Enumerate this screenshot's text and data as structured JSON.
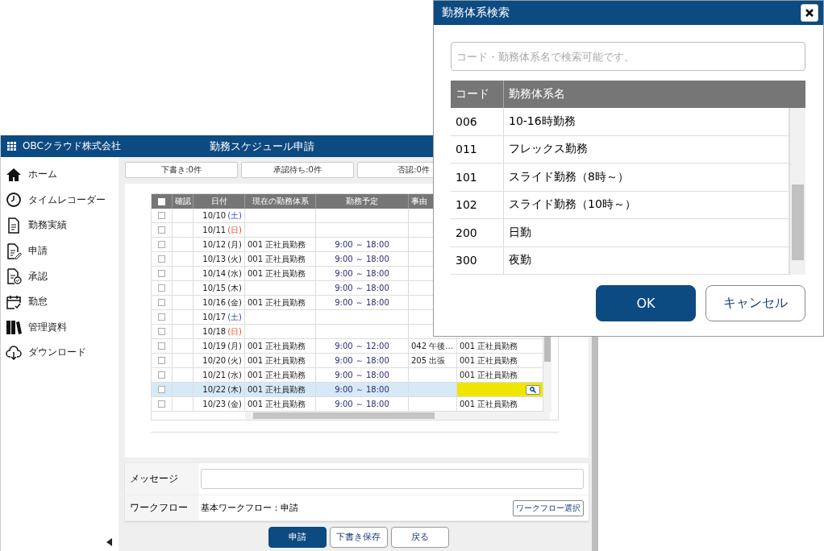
{
  "app": {
    "company": "OBCクラウド株式会社",
    "title": "勤務スケジュール申請"
  },
  "sidebar": {
    "items": [
      {
        "label": "ホーム"
      },
      {
        "label": "タイムレコーダー"
      },
      {
        "label": "勤務実績"
      },
      {
        "label": "申請"
      },
      {
        "label": "承認"
      },
      {
        "label": "勤怠"
      },
      {
        "label": "管理資料"
      },
      {
        "label": "ダウンロード"
      }
    ]
  },
  "status_tabs": [
    "下書き:0件",
    "承認待ち:0件",
    "否認:0件"
  ],
  "table": {
    "all_checked": false,
    "columns": [
      "確認",
      "日付",
      "現在の勤務体系",
      "勤務予定",
      "事由"
    ],
    "rows": [
      {
        "date": "10/10",
        "weekday": "(土)",
        "kind": "saturday",
        "current": "",
        "plan": "",
        "reason": "",
        "column_7": "",
        "selected": false,
        "checked": false
      },
      {
        "date": "10/11",
        "weekday": "(日)",
        "kind": "sunday",
        "current": "",
        "plan": "",
        "reason": "",
        "column_7": "",
        "selected": false,
        "checked": false
      },
      {
        "date": "10/12",
        "weekday": "(月)",
        "kind": "weekday",
        "current": "001 正社員勤務",
        "plan": "9:00 ～ 18:00",
        "reason": "",
        "column_7": "",
        "selected": false,
        "checked": false
      },
      {
        "date": "10/13",
        "weekday": "(火)",
        "kind": "weekday",
        "current": "001 正社員勤務",
        "plan": "9:00 ～ 18:00",
        "reason": "",
        "column_7": "",
        "selected": false,
        "checked": false
      },
      {
        "date": "10/14",
        "weekday": "(水)",
        "kind": "weekday",
        "current": "001 正社員勤務",
        "plan": "9:00 ～ 18:00",
        "reason": "",
        "column_7": "",
        "selected": false,
        "checked": false
      },
      {
        "date": "10/15",
        "weekday": "(木)",
        "kind": "weekday",
        "current": "",
        "plan": "9:00 ～ 18:00",
        "reason": "",
        "column_7": "",
        "selected": false,
        "checked": false
      },
      {
        "date": "10/16",
        "weekday": "(金)",
        "kind": "weekday",
        "current": "001 正社員勤務",
        "plan": "9:00 ～ 18:00",
        "reason": "",
        "column_7": "",
        "selected": false,
        "checked": false
      },
      {
        "date": "10/17",
        "weekday": "(土)",
        "kind": "saturday",
        "current": "",
        "plan": "",
        "reason": "",
        "column_7": "",
        "selected": false,
        "checked": false
      },
      {
        "date": "10/18",
        "weekday": "(日)",
        "kind": "sunday",
        "current": "",
        "plan": "",
        "reason": "",
        "column_7": "",
        "selected": false,
        "checked": false
      },
      {
        "date": "10/19",
        "weekday": "(月)",
        "kind": "weekday",
        "current": "001 正社員勤務",
        "plan": "9:00 ～ 12:00",
        "reason": "042 午後…",
        "column_7": "001 正社員勤務",
        "selected": false,
        "checked": false
      },
      {
        "date": "10/20",
        "weekday": "(火)",
        "kind": "weekday",
        "current": "001 正社員勤務",
        "plan": "9:00 ～ 18:00",
        "reason": "205 出張",
        "column_7": "001 正社員勤務",
        "selected": false,
        "checked": false
      },
      {
        "date": "10/21",
        "weekday": "(水)",
        "kind": "weekday",
        "current": "001 正社員勤務",
        "plan": "9:00 ～ 18:00",
        "reason": "",
        "column_7": "001 正社員勤務",
        "selected": false,
        "checked": false
      },
      {
        "date": "10/22",
        "weekday": "(木)",
        "kind": "weekday",
        "current": "001 正社員勤務",
        "plan": "9:00 ～ 18:00",
        "reason": "",
        "column_7": "",
        "selected": true,
        "checked": false
      },
      {
        "date": "10/23",
        "weekday": "(金)",
        "kind": "weekday",
        "current": "001 正社員勤務",
        "plan": "9:00 ～ 18:00",
        "reason": "",
        "column_7": "001 正社員勤務",
        "selected": false,
        "checked": false
      }
    ]
  },
  "message": {
    "label": "メッセージ"
  },
  "workflow": {
    "label": "ワークフロー",
    "value": "基本ワークフロー：申請",
    "button": "ワークフロー選択"
  },
  "actions": [
    {
      "label": "申請",
      "primary": true
    },
    {
      "label": "下書き保存",
      "primary": false
    },
    {
      "label": "戻る",
      "primary": false
    }
  ],
  "dialog": {
    "title": "勤務体系検索",
    "search": {
      "placeholder": "コード・勤務体系名で検索可能です。"
    },
    "columns": [
      "コード",
      "勤務体系名"
    ],
    "rows": [
      {
        "code": "006",
        "name": "10-16時勤務"
      },
      {
        "code": "011",
        "name": "フレックス勤務"
      },
      {
        "code": "101",
        "name": "スライド勤務（8時～）"
      },
      {
        "code": "102",
        "name": "スライド勤務（10時～）"
      },
      {
        "code": "200",
        "name": "日勤"
      },
      {
        "code": "300",
        "name": "夜勤"
      }
    ],
    "buttons": [
      {
        "label": "OK",
        "primary": true
      },
      {
        "label": "キャンセル",
        "primary": false
      }
    ]
  }
}
